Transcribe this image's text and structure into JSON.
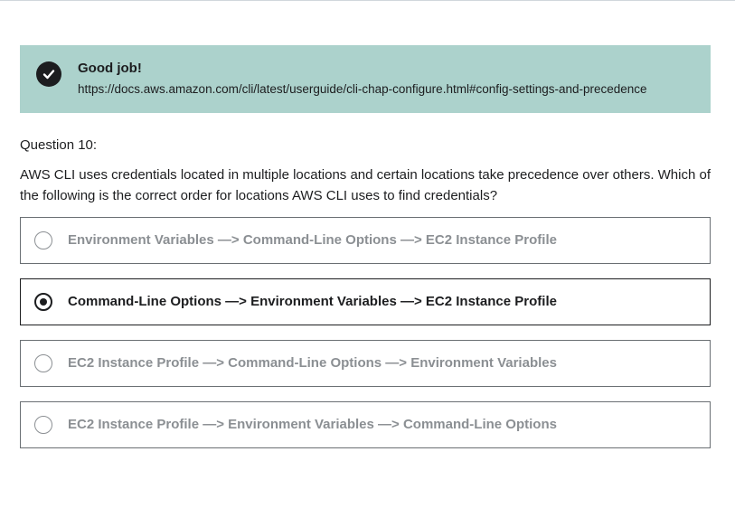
{
  "feedback": {
    "title": "Good job!",
    "link": "https://docs.aws.amazon.com/cli/latest/userguide/cli-chap-configure.html#config-settings-and-precedence",
    "icon": "check-circle-icon"
  },
  "question": {
    "number_label": "Question 10:",
    "text": "AWS CLI uses credentials located in multiple locations and certain locations take precedence over others. Which of the following is the correct order for locations AWS CLI uses to find credentials?"
  },
  "options": [
    {
      "label": "Environment Variables —> Command-Line Options —> EC2 Instance Profile",
      "selected": false
    },
    {
      "label": "Command-Line Options —> Environment Variables —> EC2 Instance Profile",
      "selected": true
    },
    {
      "label": "EC2 Instance Profile —> Command-Line Options —> Environment Variables",
      "selected": false
    },
    {
      "label": "EC2 Instance Profile —> Environment Variables —> Command-Line Options",
      "selected": false
    }
  ],
  "colors": {
    "banner_bg": "#acd2cc",
    "text": "#1c1d1f",
    "muted_text": "#8b8f93"
  }
}
